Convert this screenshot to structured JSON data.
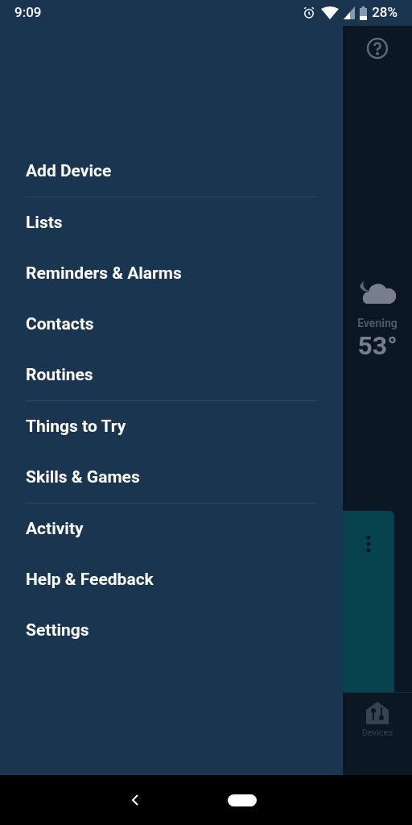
{
  "status_bar": {
    "time": "9:09",
    "battery": "28%"
  },
  "menu_groups": [
    {
      "items": [
        {
          "label": "Add Device"
        }
      ]
    },
    {
      "items": [
        {
          "label": "Lists"
        },
        {
          "label": "Reminders & Alarms"
        },
        {
          "label": "Contacts"
        },
        {
          "label": "Routines"
        }
      ]
    },
    {
      "items": [
        {
          "label": "Things to Try"
        },
        {
          "label": "Skills & Games"
        }
      ]
    },
    {
      "items": [
        {
          "label": "Activity"
        },
        {
          "label": "Help & Feedback"
        },
        {
          "label": "Settings"
        }
      ]
    }
  ],
  "background": {
    "weather": {
      "period": "Evening",
      "temperature": "53°"
    },
    "bottom_tab": {
      "label": "Devices"
    }
  }
}
